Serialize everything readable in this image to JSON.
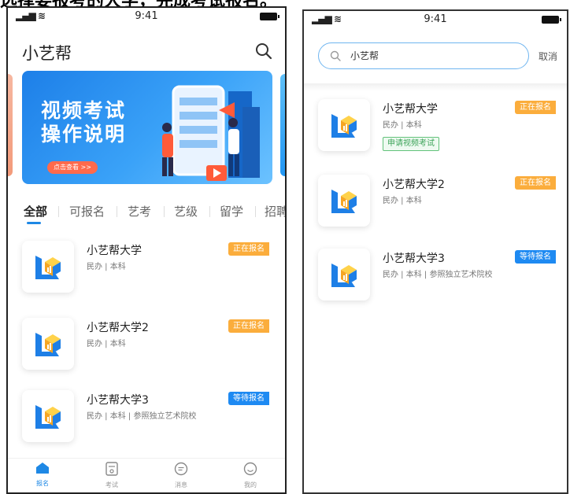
{
  "caption": "选择要报考的大学，完成考试报名。",
  "status_bar": {
    "time": "9:41"
  },
  "home": {
    "title": "小艺帮",
    "banner": {
      "title_line1": "视频考试",
      "title_line2": "操作说明",
      "button": "点击查看 >>"
    },
    "tabs": [
      {
        "label": "全部",
        "active": true
      },
      {
        "label": "可报名"
      },
      {
        "label": "艺考"
      },
      {
        "label": "艺级"
      },
      {
        "label": "留学"
      },
      {
        "label": "招聘"
      }
    ],
    "schools": [
      {
        "name": "小艺帮大学",
        "meta": "民办 | 本科",
        "status": "正在报名",
        "status_color": "#fbad3c"
      },
      {
        "name": "小艺帮大学2",
        "meta": "民办 | 本科",
        "status": "正在报名",
        "status_color": "#fbad3c"
      },
      {
        "name": "小艺帮大学3",
        "meta": "民办 | 本科 | 参照独立艺术院校",
        "status": "等待报名",
        "status_color": "#1e8af2"
      }
    ],
    "tabbar": [
      {
        "label": "报名",
        "icon": "home-icon",
        "active": true
      },
      {
        "label": "考试",
        "icon": "exam-icon"
      },
      {
        "label": "消息",
        "icon": "message-icon"
      },
      {
        "label": "我的",
        "icon": "profile-icon"
      }
    ]
  },
  "search_page": {
    "query": "小艺帮",
    "cancel": "取消",
    "results": [
      {
        "name": "小艺帮大学",
        "meta": "民办 | 本科",
        "status": "正在报名",
        "tag": "申请视频考试"
      },
      {
        "name": "小艺帮大学2",
        "meta": "民办 | 本科",
        "status": "正在报名"
      },
      {
        "name": "小艺帮大学3",
        "meta": "民办 | 本科 | 参照独立艺术院校",
        "status": "等待报名"
      }
    ]
  },
  "colors": {
    "accent": "#1e88e5",
    "status_open": "#fbad3c",
    "status_wait": "#1e8af2",
    "tag_green": "#3ea45a"
  }
}
